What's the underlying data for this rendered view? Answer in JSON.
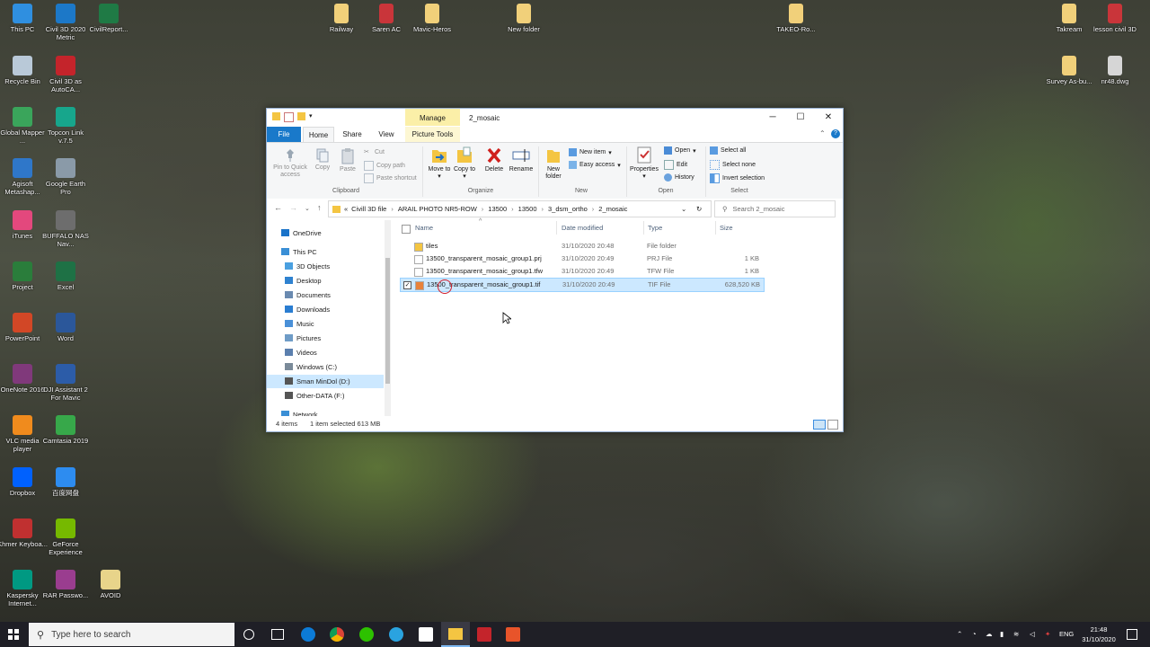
{
  "desktop": {
    "icons_left": [
      {
        "label": "This PC",
        "color": "#2f8fe0"
      },
      {
        "label": "Civil 3D 2020 Metric",
        "color": "#1c78c8"
      },
      {
        "label": "CivilReport...",
        "color": "#1f7a45"
      },
      {
        "label": "Recycle Bin",
        "color": "#b9c9d8"
      },
      {
        "label": "Civil 3D as AutoCA...",
        "color": "#c4242b"
      },
      {
        "label": "Global Mapper ...",
        "color": "#3aa55b"
      },
      {
        "label": "Topcon Link v.7.5",
        "color": "#17a68c"
      },
      {
        "label": "Agisoft Metashap...",
        "color": "#2f77c9"
      },
      {
        "label": "Google Earth Pro",
        "color": "#8a9aa8"
      },
      {
        "label": "iTunes",
        "color": "#e3487d"
      },
      {
        "label": "BUFFALO NAS Nav...",
        "color": "#6d6d6d"
      },
      {
        "label": "Project",
        "color": "#2a7d3b"
      },
      {
        "label": "Excel",
        "color": "#1e7145"
      },
      {
        "label": "PowerPoint",
        "color": "#d24726"
      },
      {
        "label": "Word",
        "color": "#2b579a"
      },
      {
        "label": "OneNote 2016",
        "color": "#80397b"
      },
      {
        "label": "DJI Assistant 2 For Mavic",
        "color": "#2c5ca8"
      },
      {
        "label": "VLC media player",
        "color": "#f08b1d"
      },
      {
        "label": "Camtasia 2019",
        "color": "#37a84a"
      },
      {
        "label": "Dropbox",
        "color": "#0061fe"
      },
      {
        "label": "百度网盘",
        "color": "#2d8cf0"
      },
      {
        "label": "Khmer Keyboa...",
        "color": "#c03030"
      },
      {
        "label": "GeForce Experience",
        "color": "#76b900"
      },
      {
        "label": "Kaspersky Internet...",
        "color": "#009982"
      },
      {
        "label": "RAR Passwo...",
        "color": "#9a3d8f"
      },
      {
        "label": "AVOID",
        "color": "#e8d48a"
      }
    ],
    "icons_top": [
      {
        "label": "Railway",
        "color": "#f1d07a"
      },
      {
        "label": "Saren AC",
        "color": "#c9353a"
      },
      {
        "label": "Mavic-Heros",
        "color": "#f1d07a"
      },
      {
        "label": "New folder",
        "color": "#f1d07a"
      },
      {
        "label": "TAKEO-Ro...",
        "color": "#f1d07a"
      },
      {
        "label": "Takream",
        "color": "#f1d07a"
      },
      {
        "label": "lesson civil 3D",
        "color": "#c9353a"
      },
      {
        "label": "Survey As-bu...",
        "color": "#f1d07a"
      },
      {
        "label": "nr48.dwg",
        "color": "#d6d6d6"
      }
    ]
  },
  "window": {
    "title": "2_mosaic",
    "manage_label": "Manage",
    "tabs": {
      "file": "File",
      "home": "Home",
      "share": "Share",
      "view": "View",
      "picture_tools": "Picture Tools"
    },
    "ribbon": {
      "pin": "Pin to Quick access",
      "copy": "Copy",
      "paste": "Paste",
      "cut": "Cut",
      "copy_path": "Copy path",
      "paste_shortcut": "Paste shortcut",
      "clipboard": "Clipboard",
      "move_to": "Move to",
      "copy_to": "Copy to",
      "delete": "Delete",
      "rename": "Rename",
      "organize": "Organize",
      "new_folder": "New folder",
      "new_item": "New item",
      "easy_access": "Easy access",
      "new": "New",
      "properties": "Properties",
      "open": "Open",
      "edit": "Edit",
      "history": "History",
      "open_group": "Open",
      "select_all": "Select all",
      "select_none": "Select none",
      "invert_selection": "Invert selection",
      "select": "Select"
    },
    "address": {
      "prefix": "«",
      "crumbs": [
        "Civill 3D file",
        "ARAIL PHOTO NR5-ROW",
        "13500",
        "13500",
        "3_dsm_ortho",
        "2_mosaic"
      ],
      "search_placeholder": "Search 2_mosaic"
    },
    "nav": [
      {
        "label": "OneDrive",
        "color": "#1a73c9"
      },
      {
        "label": "This PC",
        "color": "#3a8fd6"
      },
      {
        "label": "3D Objects",
        "color": "#4aa0e0"
      },
      {
        "label": "Desktop",
        "color": "#2f82d0"
      },
      {
        "label": "Documents",
        "color": "#6a8ab0"
      },
      {
        "label": "Downloads",
        "color": "#2a7dd1"
      },
      {
        "label": "Music",
        "color": "#4a90d8"
      },
      {
        "label": "Pictures",
        "color": "#6f9cc7"
      },
      {
        "label": "Videos",
        "color": "#5b7fae"
      },
      {
        "label": "Windows (C:)",
        "color": "#7a8a99"
      },
      {
        "label": "Sman MinDol (D:)",
        "color": "#555555"
      },
      {
        "label": "Other-DATA (F:)",
        "color": "#555555"
      },
      {
        "label": "Network",
        "color": "#3a8fd6"
      }
    ],
    "columns": {
      "name": "Name",
      "date": "Date modified",
      "type": "Type",
      "size": "Size"
    },
    "files": [
      {
        "name": "tiles",
        "date": "31/10/2020 20:48",
        "type": "File folder",
        "size": ""
      },
      {
        "name": "13500_transparent_mosaic_group1.prj",
        "date": "31/10/2020 20:49",
        "type": "PRJ File",
        "size": "1 KB"
      },
      {
        "name": "13500_transparent_mosaic_group1.tfw",
        "date": "31/10/2020 20:49",
        "type": "TFW File",
        "size": "1 KB"
      },
      {
        "name": "13500_transparent_mosaic_group1.tif",
        "date": "31/10/2020 20:49",
        "type": "TIF File",
        "size": "628,520 KB"
      }
    ],
    "status": {
      "items": "4 items",
      "selected": "1 item selected  613 MB"
    }
  },
  "taskbar": {
    "search_placeholder": "Type here to search",
    "language": "ENG",
    "time": "21:48",
    "date": "31/10/2020"
  }
}
